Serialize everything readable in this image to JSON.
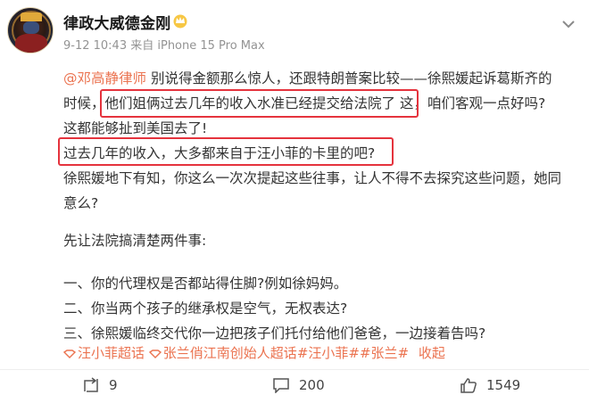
{
  "post": {
    "author": "律政大威德金刚",
    "meta": "9-12 10:43  来自 iPhone 15 Pro Max",
    "lines": [
      {
        "mention": "@邓高静律师",
        "text": " 别说得金额那么惊人，还跟特朗普案比较——徐熙媛起诉葛斯齐的"
      },
      {
        "pre": "时候，",
        "highlight": "他们姐俩过去几年的收入水准已经提交给法院了",
        "post": "  这，咱们客观一点好吗?"
      },
      {
        "text": "这都能够扯到美国去了!"
      },
      {
        "highlight": "过去几年的收入，大多都来自于汪小菲的卡里的吧?"
      },
      {
        "text": "徐熙媛地下有知，你这么一次次提起这些往事，让人不得不去探究这些问题，她同"
      },
      {
        "text": "意么?"
      },
      {
        "text": ""
      },
      {
        "text": "先让法院搞清楚两件事:"
      },
      {
        "text": ""
      },
      {
        "text": "一、你的代理权是否都站得住脚?例如徐妈妈。"
      },
      {
        "text": "二、你当两个孩子的继承权是空气，无权表达?"
      },
      {
        "text": "三、徐熙媛临终交代你一边把孩子们托付给他们爸爸，一边接着告吗?"
      }
    ],
    "topics": [
      "汪小菲超话",
      "张兰俏江南创始人超话",
      "#汪小菲#",
      "#张兰#"
    ],
    "collapse_label": "收起"
  },
  "actions": {
    "repost_count": "9",
    "comment_count": "200",
    "like_count": "1549"
  },
  "colors": {
    "accent": "#eb7350",
    "highlight_border": "#e5333d",
    "meta": "#939393"
  }
}
